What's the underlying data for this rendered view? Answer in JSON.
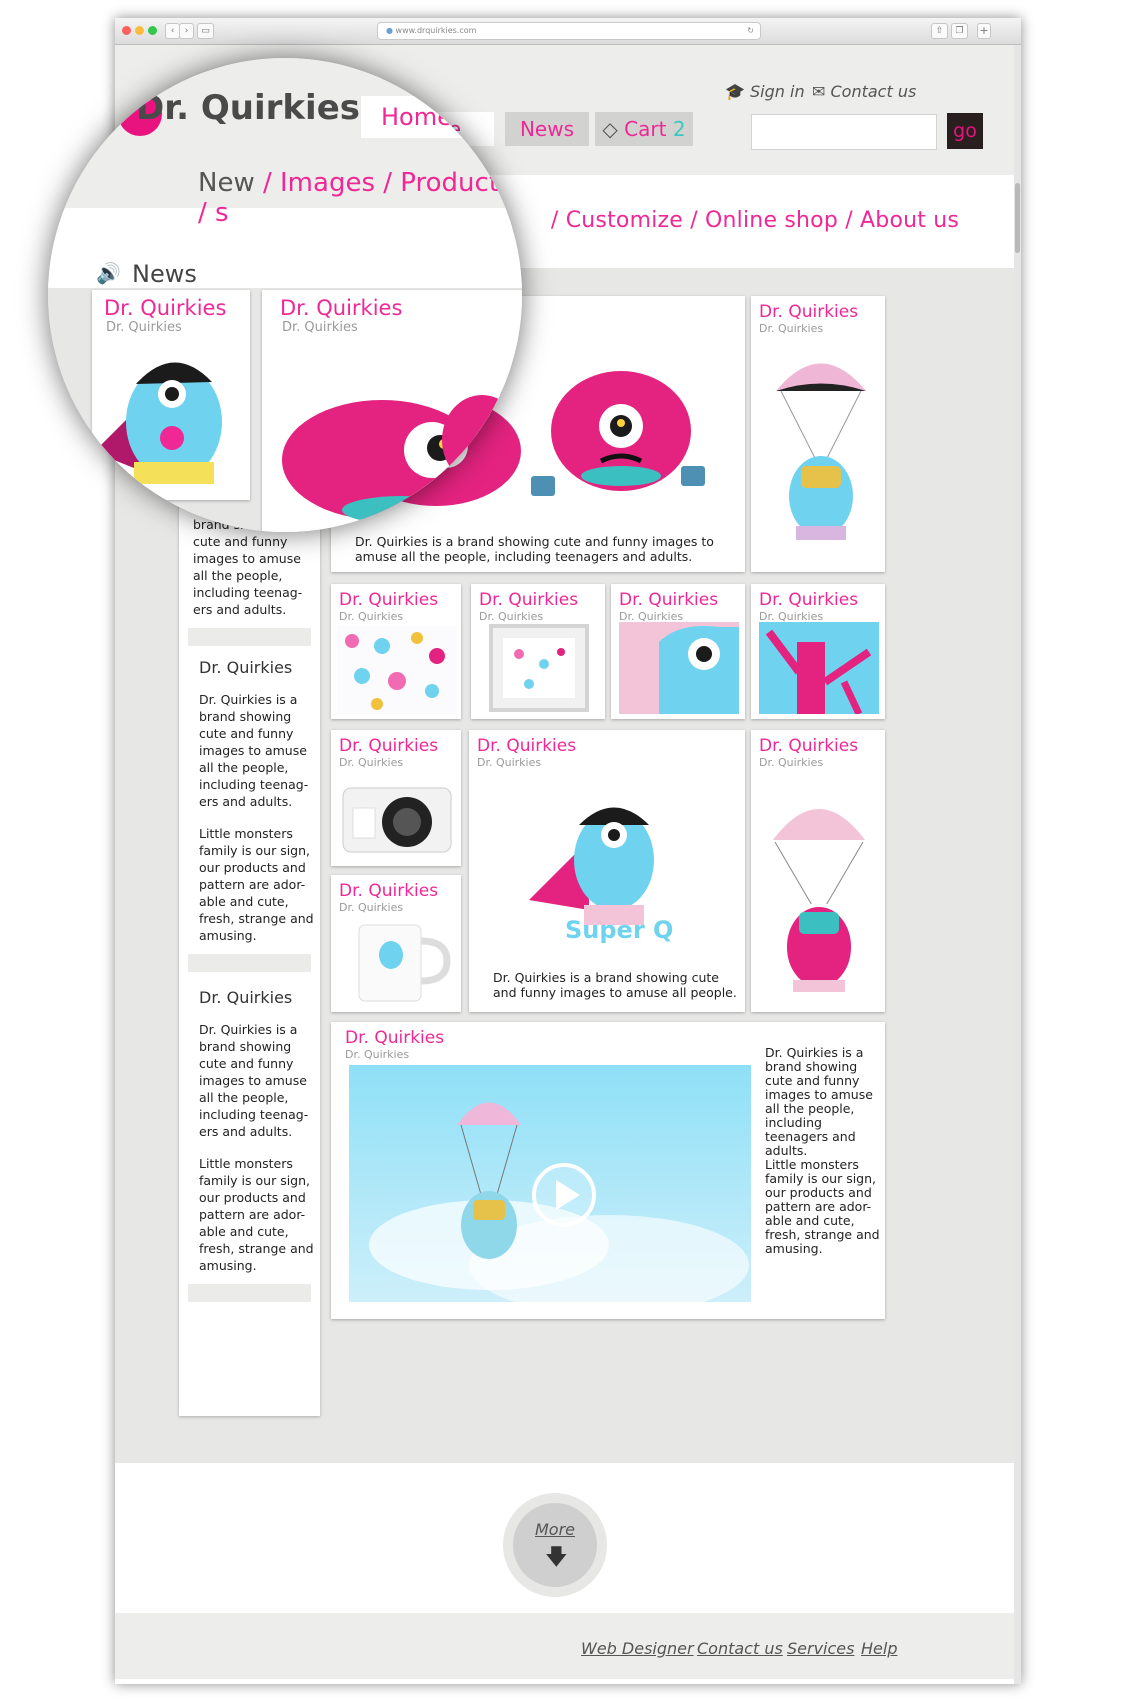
{
  "browser": {
    "url": "www.drquirkies.com"
  },
  "header": {
    "brand": "Dr. Quirkies",
    "top_links": [
      "Sign in",
      "Contact us"
    ],
    "nav": [
      {
        "label": "Home",
        "active": true
      },
      {
        "label": "News"
      },
      {
        "label": "Cart 2",
        "cart_count": "2",
        "cart_word": "Cart"
      }
    ],
    "search_placeholder": "",
    "go_label": "go"
  },
  "subnav": {
    "first": "New",
    "items": [
      "Images",
      "Products",
      "s",
      "Customize",
      "Online shop",
      "About us"
    ],
    "sep": " / "
  },
  "section": {
    "title": "News"
  },
  "card_title": "Dr. Quirkies",
  "card_subtitle": "Dr. Quirkies",
  "texts": {
    "brand_long": "Dr. Quirkies is a brand showing cute and funny images to amuse all the people, including teenagers and adults.",
    "brand_short": "Dr. Quirkies is a brand showing cute and funny images to amuse all  people.",
    "sidebar_p1": "Dr. Quirkies is a brand showing cute and funny images to amuse all the people, including teenag-ers and adults.",
    "sidebar_top_partial": "brand showing cute and funny images to amuse all the people, including teenag-ers and adults.",
    "sidebar_p2": "Little monsters family is our sign, our products and pattern are ador-able and cute, fresh, strange and amusing.",
    "video_p1": "Dr. Quirkies is a brand showing cute and funny images to amuse all the people, including teenagers and adults.",
    "video_p2": "Little monsters family is our sign, our products and pattern are ador-able and cute, fresh, strange and amusing.",
    "sidebar_heading": "Dr. Quirkies",
    "partial_sies": "ies"
  },
  "super_q": "Super Q",
  "more": {
    "label": "More"
  },
  "footer": {
    "links": [
      "Web Designer",
      "Contact us",
      "Services",
      "Help"
    ]
  },
  "colors": {
    "pink": "#ef2896",
    "cyan": "#6fd3ef",
    "light_pink": "#f3c3d8",
    "dark": "#2a1f1f"
  }
}
